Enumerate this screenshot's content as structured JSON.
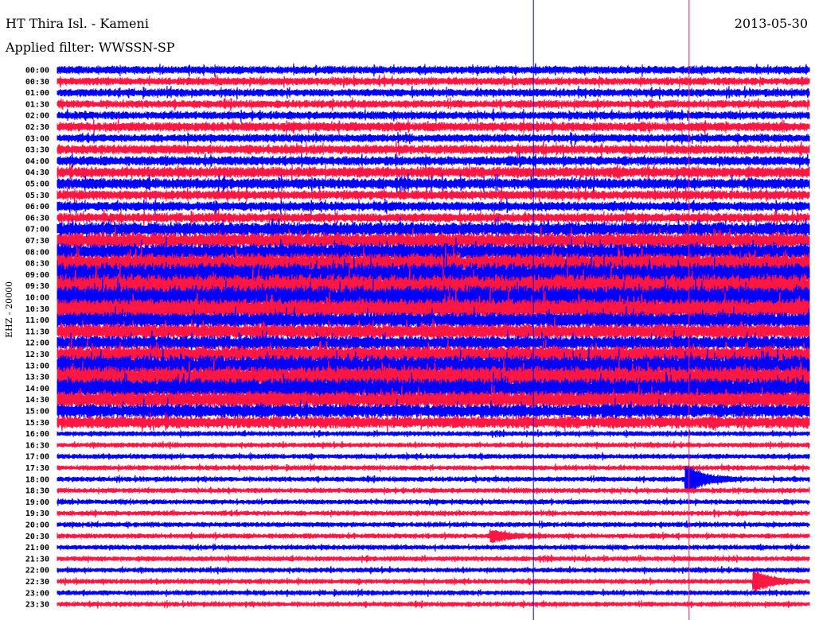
{
  "header": {
    "title": "HT Thira Isl. - Kameni",
    "filter": "Applied filter: WWSSN-SP",
    "date": "2013-05-30"
  },
  "chart_data": {
    "type": "line",
    "subtype": "helicorder",
    "ylabel": "EHZ - 20000",
    "colors": [
      "#0000ff",
      "#ff1744"
    ],
    "row_labels": [
      "00:00",
      "00:30",
      "01:00",
      "01:30",
      "02:00",
      "02:30",
      "03:00",
      "03:30",
      "04:00",
      "04:30",
      "05:00",
      "05:30",
      "06:00",
      "06:30",
      "07:00",
      "07:30",
      "08:00",
      "08:30",
      "09:00",
      "09:30",
      "10:00",
      "10:30",
      "11:00",
      "11:30",
      "12:00",
      "12:30",
      "13:00",
      "13:30",
      "14:00",
      "14:30",
      "15:00",
      "15:30",
      "16:00",
      "16:30",
      "17:00",
      "17:30",
      "18:00",
      "18:30",
      "19:00",
      "19:30",
      "20:00",
      "20:30",
      "21:00",
      "21:30",
      "22:00",
      "22:30",
      "23:00",
      "23:30"
    ],
    "relative_amplitude": [
      5,
      5,
      5,
      5,
      5,
      6,
      5,
      6,
      6,
      7,
      7,
      6,
      6,
      6,
      9,
      10,
      11,
      13,
      15,
      15,
      15,
      13,
      10,
      10,
      9,
      11,
      13,
      14,
      13,
      11,
      9,
      8,
      3,
      3,
      3,
      3,
      3,
      3,
      3,
      3,
      3,
      3,
      3,
      3,
      3,
      3,
      3,
      3
    ],
    "events": [
      {
        "row": "18:00",
        "position": 0.84,
        "amplitude": 14
      },
      {
        "row": "22:30",
        "position": 0.93,
        "amplitude": 10
      },
      {
        "row": "20:30",
        "position": 0.58,
        "amplitude": 6
      }
    ],
    "markers": [
      {
        "position": 0.633,
        "color": "#0000ff"
      },
      {
        "position": 0.84,
        "color": "#ff1744"
      }
    ]
  }
}
